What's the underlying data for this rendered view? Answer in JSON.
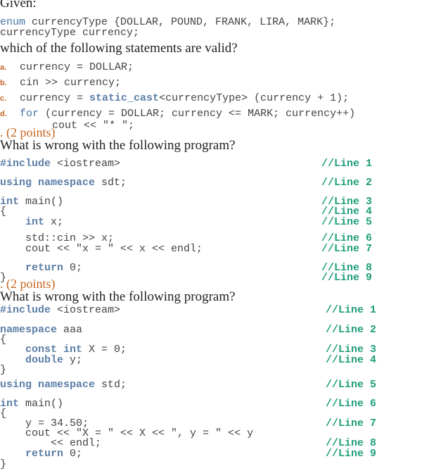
{
  "q1": {
    "intro": "Given:",
    "code_line1_kw": "enum",
    "code_line1_rest": " currencyType {DOLLAR, POUND, FRANK, LIRA, MARK};",
    "code_line2": "currencyType currency;",
    "question": "which of the following statements are valid?",
    "options": [
      {
        "label": "a.",
        "text": "currency = DOLLAR;"
      },
      {
        "label": "b.",
        "text": "cin >> currency;"
      },
      {
        "label": "c.",
        "pre": "currency = ",
        "kw": "static_cast",
        "post": "<currencyType> (currency + 1);"
      },
      {
        "label": "d.",
        "kw": "for",
        "post": " (currency = DOLLAR; currency <= MARK; currency++)",
        "cont": "cout << \"* \";"
      }
    ]
  },
  "q2": {
    "points": ". (2 points)",
    "question": "What is wrong with the following program?",
    "lines": [
      {
        "kw": "#include",
        "rest": " <iostream>",
        "comment": "//Line 1"
      },
      {
        "kw": "using namespace",
        "rest": " sdt;",
        "comment": "//Line 2"
      },
      {
        "kw": "int",
        "rest": " main()",
        "comment": "//Line 3"
      },
      {
        "rest": "{",
        "comment": "//Line 4"
      },
      {
        "indent": "    ",
        "kw": "int",
        "rest": " x;",
        "comment": "//Line 5"
      },
      {
        "indent": "    ",
        "rest": "std::cin >> x;",
        "comment": "//Line 6"
      },
      {
        "indent": "    ",
        "rest": "cout << \"x = \" << x << endl;",
        "comment": "//Line 7"
      },
      {
        "indent": "    ",
        "kw": "return",
        "rest": " 0;",
        "comment": "//Line 8"
      },
      {
        "rest": "}",
        "comment": "//Line 9"
      }
    ]
  },
  "q3": {
    "points": ". (2 points)",
    "question": "What is wrong with the following program?",
    "lines": [
      {
        "kw": "#include",
        "rest": " <iostream>",
        "comment": "//Line 1"
      },
      {
        "kw": "namespace",
        "rest": " aaa",
        "comment": "//Line 2"
      },
      {
        "rest": "{",
        "comment": ""
      },
      {
        "indent": "    ",
        "kw": "const int",
        "rest": " X = 0;",
        "comment": "//Line 3"
      },
      {
        "indent": "    ",
        "kw": "double",
        "rest": " y;",
        "comment": "//Line 4"
      },
      {
        "rest": "}",
        "comment": ""
      },
      {
        "kw": "using namespace",
        "rest": " std;",
        "comment": "//Line 5"
      },
      {
        "kw": "int",
        "rest": " main()",
        "comment": "//Line 6"
      },
      {
        "rest": "{",
        "comment": ""
      },
      {
        "indent": "    ",
        "rest": "y = 34.50;",
        "comment": "//Line 7"
      },
      {
        "indent": "    ",
        "rest": "cout << \"X = \" << X << \", y = \" << y",
        "comment": ""
      },
      {
        "indent": "        ",
        "rest": "<< endl;",
        "comment": "//Line 8"
      },
      {
        "indent": "    ",
        "kw": "return",
        "rest": " 0;",
        "comment": "//Line 9"
      },
      {
        "rest": "}",
        "comment": ""
      }
    ]
  }
}
